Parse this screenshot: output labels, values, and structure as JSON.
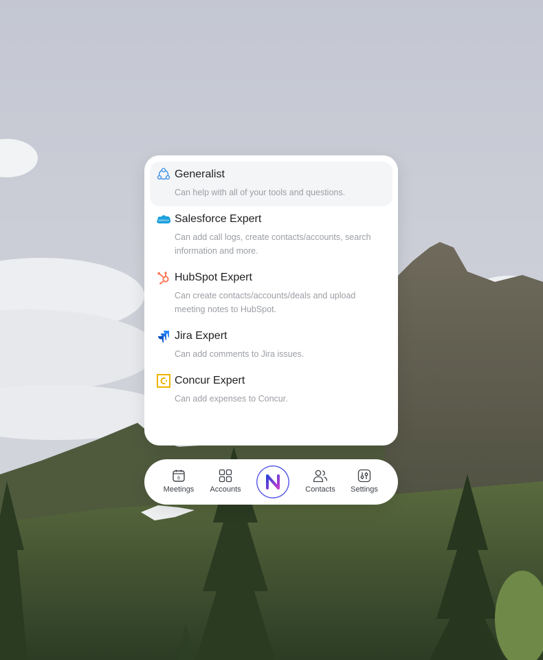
{
  "agents": [
    {
      "title": "Generalist",
      "description": "Can help with all of your tools and questions.",
      "icon": "generalist-icon",
      "selected": true
    },
    {
      "title": "Salesforce Expert",
      "description": "Can add call logs, create contacts/accounts, search information and more.",
      "icon": "salesforce-icon"
    },
    {
      "title": "HubSpot Expert",
      "description": "Can create contacts/accounts/deals and upload meeting notes to HubSpot.",
      "icon": "hubspot-icon"
    },
    {
      "title": "Jira Expert",
      "description": "Can add comments to Jira issues.",
      "icon": "jira-icon"
    },
    {
      "title": "Concur Expert",
      "description": "Can add expenses to Concur.",
      "icon": "concur-icon"
    }
  ],
  "nav": {
    "meetings_label": "Meetings",
    "meetings_day": "8",
    "accounts_label": "Accounts",
    "contacts_label": "Contacts",
    "settings_label": "Settings"
  },
  "colors": {
    "salesforce": "#1ea0dc",
    "hubspot": "#ff7a59",
    "jira": "#2684ff",
    "concur": "#f0b400",
    "brand_gradient_start": "#2d43d8",
    "brand_gradient_end": "#c43bd0"
  }
}
